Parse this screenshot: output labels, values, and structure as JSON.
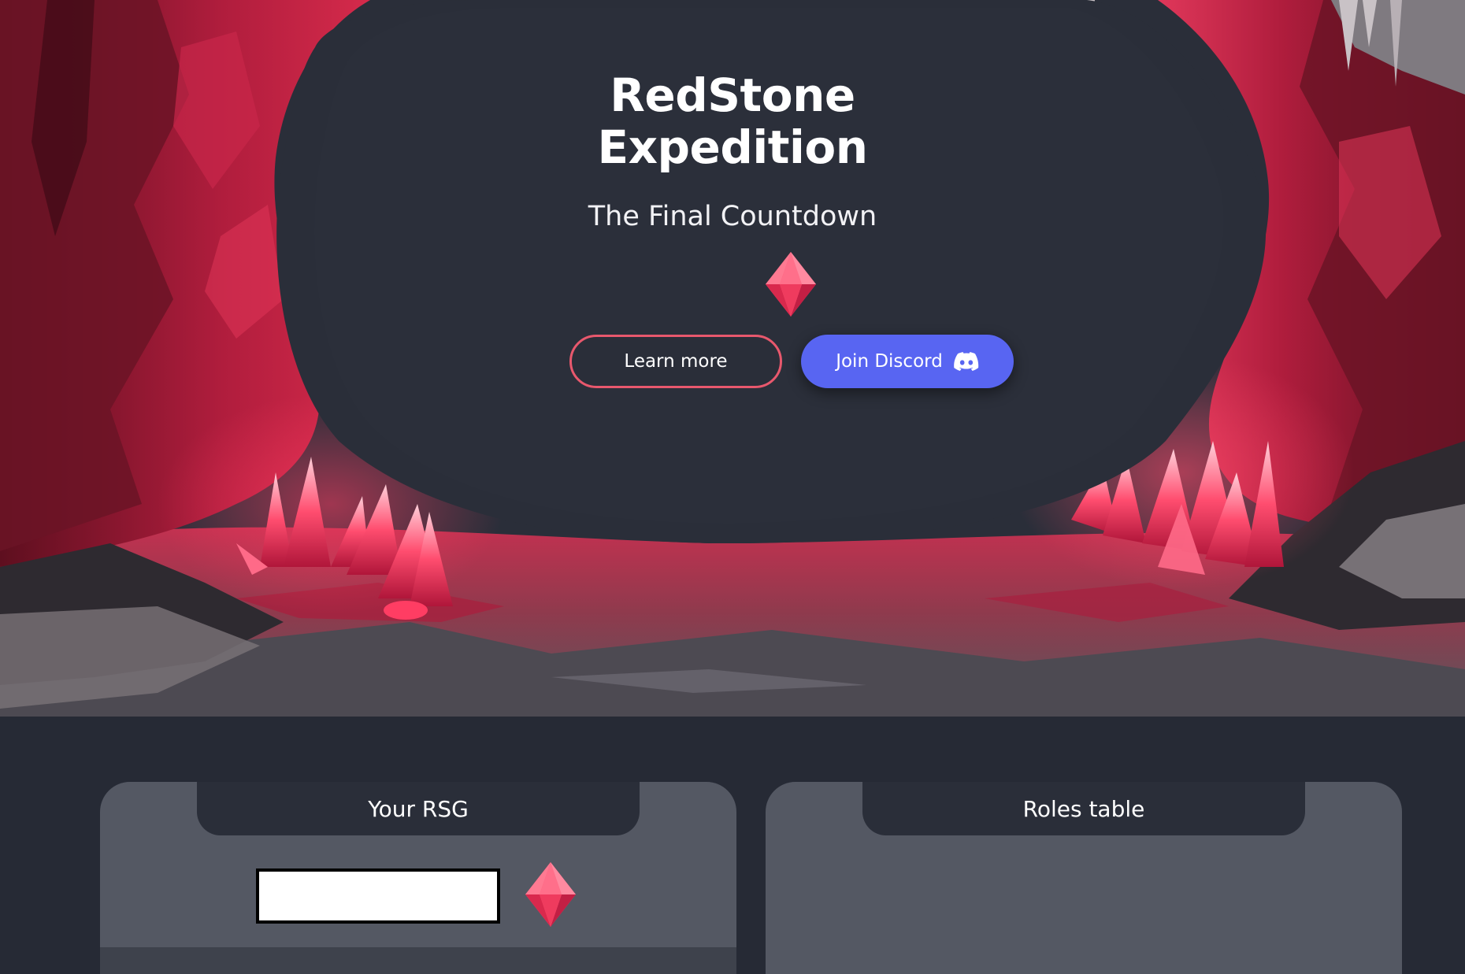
{
  "hero": {
    "title_line1": "RedStone",
    "title_line2": "Expedition",
    "subtitle": "The Final Countdown",
    "gem_icon": "redstone-gem-icon",
    "learn_more_label": "Learn more",
    "discord_label": "Join Discord",
    "discord_icon": "discord-icon"
  },
  "cards": {
    "rsg": {
      "title": "Your RSG",
      "input_value": "",
      "gem_icon": "redstone-gem-icon"
    },
    "roles": {
      "title": "Roles table"
    }
  },
  "colors": {
    "background": "#262a35",
    "hero_center": "#2a2e39",
    "card": "#545863",
    "accent_red": "#e8586d",
    "discord": "#5865f2",
    "crystal": "#ff3d63"
  }
}
